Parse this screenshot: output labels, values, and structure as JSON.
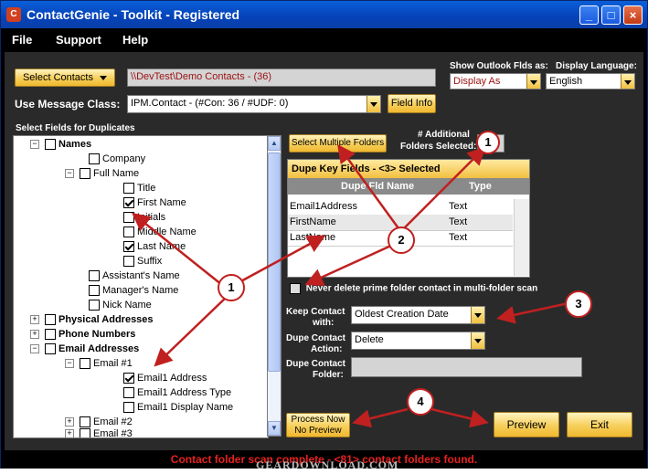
{
  "window": {
    "title": "ContactGenie - Toolkit - Registered",
    "minimize": "_",
    "maximize": "□",
    "close": "×"
  },
  "menu": [
    "File",
    "Support",
    "Help"
  ],
  "select_contacts": {
    "label": "Select Contacts",
    "value": "\\\\DevTest\\Demo Contacts - (36)"
  },
  "outlook": {
    "label": "Show Outlook Flds as:",
    "value": "Display As"
  },
  "language": {
    "label": "Display Language:",
    "value": "English"
  },
  "message_class": {
    "label": "Use Message Class:",
    "value": "IPM.Contact - (#Con: 36 / #UDF: 0)",
    "info_button": "Field Info"
  },
  "fields_label": "Select Fields for Duplicates",
  "tree": [
    {
      "label": "Names",
      "bold": true,
      "checked": false,
      "expander": "−"
    },
    {
      "label": "Company",
      "checked": false
    },
    {
      "label": "Full Name",
      "checked": false,
      "expander": "−"
    },
    {
      "label": "Title",
      "checked": false
    },
    {
      "label": "First Name",
      "checked": true
    },
    {
      "label": "Initials",
      "checked": false
    },
    {
      "label": "Middle Name",
      "checked": false
    },
    {
      "label": "Last Name",
      "checked": true
    },
    {
      "label": "Suffix",
      "checked": false
    },
    {
      "label": "Assistant's Name",
      "checked": false
    },
    {
      "label": "Manager's Name",
      "checked": false
    },
    {
      "label": "Nick Name",
      "checked": false
    },
    {
      "label": "Physical Addresses",
      "bold": true,
      "checked": false,
      "expander": "+"
    },
    {
      "label": "Phone Numbers",
      "bold": true,
      "checked": false,
      "expander": "+"
    },
    {
      "label": "Email Addresses",
      "bold": true,
      "checked": false,
      "expander": "−"
    },
    {
      "label": "Email #1",
      "checked": false,
      "expander": "−"
    },
    {
      "label": "Email1 Address",
      "checked": true
    },
    {
      "label": "Email1 Address Type",
      "checked": false
    },
    {
      "label": "Email1 Display Name",
      "checked": false
    },
    {
      "label": "Email #2",
      "checked": false,
      "expander": "+"
    },
    {
      "label": "Email #3",
      "checked": false,
      "expander": "+"
    }
  ],
  "multi_folder": {
    "button": "Select Multiple Folders",
    "additional_label_1": "# Additional",
    "additional_label_2": "Folders Selected:",
    "count": "1"
  },
  "dupe_grid": {
    "header": "Dupe Key Fields - <3> Selected",
    "col_name": "Dupe Fld Name",
    "col_type": "Type",
    "rows": [
      {
        "name": "Email1Address",
        "type": "Text"
      },
      {
        "name": "FirstName",
        "type": "Text"
      },
      {
        "name": "LastName",
        "type": "Text"
      }
    ]
  },
  "never_delete": {
    "label": "Never delete prime folder contact in multi-folder scan",
    "checked": false
  },
  "keep_contact": {
    "label_1": "Keep Contact",
    "label_2": "with:",
    "value": "Oldest Creation Date"
  },
  "dupe_action": {
    "label_1": "Dupe Contact",
    "label_2": "Action:",
    "value": "Delete"
  },
  "dupe_folder": {
    "label_1": "Dupe Contact",
    "label_2": "Folder:",
    "value": ""
  },
  "buttons": {
    "process_1": "Process Now",
    "process_2": "No Preview",
    "preview": "Preview",
    "exit": "Exit"
  },
  "callouts": [
    "1",
    "2",
    "3",
    "4",
    "1"
  ],
  "status": "Contact folder scan complete - <81> contact folders found.",
  "watermark": "GEARDOWNLOAD.COM",
  "colors": {
    "title_bar": "#0542b8",
    "panel": "#2a2a2a",
    "button_gold": "#f6cf5a",
    "status_red": "#e82020",
    "callout_red": "#c02020"
  }
}
